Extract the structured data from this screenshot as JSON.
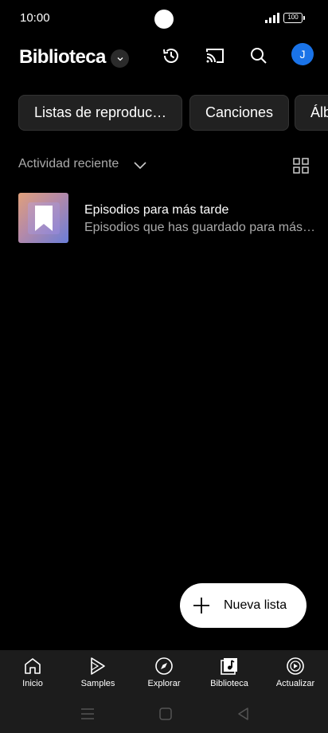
{
  "status": {
    "time": "10:00",
    "battery": "100"
  },
  "header": {
    "title": "Biblioteca",
    "avatar_letter": "J"
  },
  "chips": [
    {
      "label": "Listas de reproduc…"
    },
    {
      "label": "Canciones"
    },
    {
      "label": "Álb"
    }
  ],
  "section": {
    "label": "Actividad reciente"
  },
  "items": [
    {
      "title": "Episodios para más tarde",
      "subtitle": "Episodios que has guardado para más…"
    }
  ],
  "fab": {
    "label": "Nueva lista"
  },
  "nav": [
    {
      "label": "Inicio",
      "icon": "home-icon"
    },
    {
      "label": "Samples",
      "icon": "samples-icon"
    },
    {
      "label": "Explorar",
      "icon": "compass-icon"
    },
    {
      "label": "Biblioteca",
      "icon": "library-icon"
    },
    {
      "label": "Actualizar",
      "icon": "upgrade-icon"
    }
  ],
  "colors": {
    "accent": "#1a73e8",
    "background": "#000000",
    "nav_bg": "#1c1c1c"
  }
}
